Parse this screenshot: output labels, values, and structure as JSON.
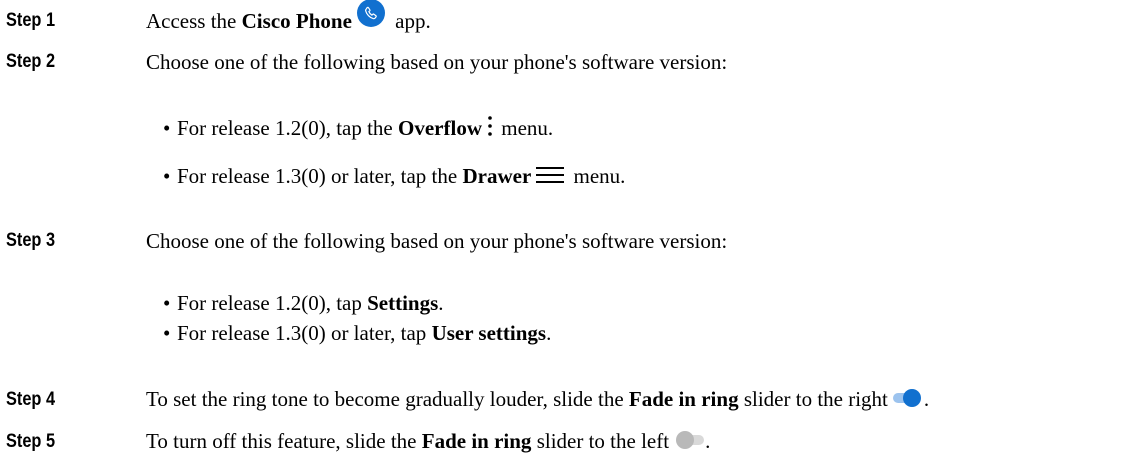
{
  "steps": [
    {
      "label": "Step 1",
      "pre": "Access the ",
      "b": "Cisco Phone",
      "post": " app."
    },
    {
      "label": "Step 2",
      "text": "Choose one of the following based on your phone's software version:",
      "bullets": [
        {
          "bullet": "•",
          "pre": "For release 1.2(0), tap the ",
          "b": "Overflow",
          "post": " menu."
        },
        {
          "bullet": "•",
          "pre": "For release 1.3(0) or later, tap the ",
          "b": "Drawer",
          "post": " menu."
        }
      ]
    },
    {
      "label": "Step 3",
      "text": "Choose one of the following based on your phone's software version:",
      "bullets": [
        {
          "bullet": "•",
          "pre": "For release 1.2(0), tap ",
          "b": "Settings",
          "post": "."
        },
        {
          "bullet": "•",
          "pre": "For release 1.3(0) or later, tap ",
          "b": "User settings",
          "post": "."
        }
      ]
    },
    {
      "label": "Step 4",
      "pre": "To set the ring tone to become gradually louder, slide the ",
      "b": "Fade in ring",
      "post": " slider to the right",
      "post2": "."
    },
    {
      "label": "Step 5",
      "pre": "To turn off this feature, slide the ",
      "b": "Fade in ring",
      "post": " slider to the left",
      "post2": "."
    }
  ],
  "colors": {
    "accent": "#1170cf",
    "toggle_off": "#c8c8c8",
    "toggle_knob_off": "#b0b0b0"
  },
  "icons": {
    "phone": "phone-icon",
    "overflow": "kebab-menu-icon",
    "drawer": "hamburger-menu-icon",
    "toggle_on": "toggle-on-icon",
    "toggle_off": "toggle-off-icon"
  }
}
